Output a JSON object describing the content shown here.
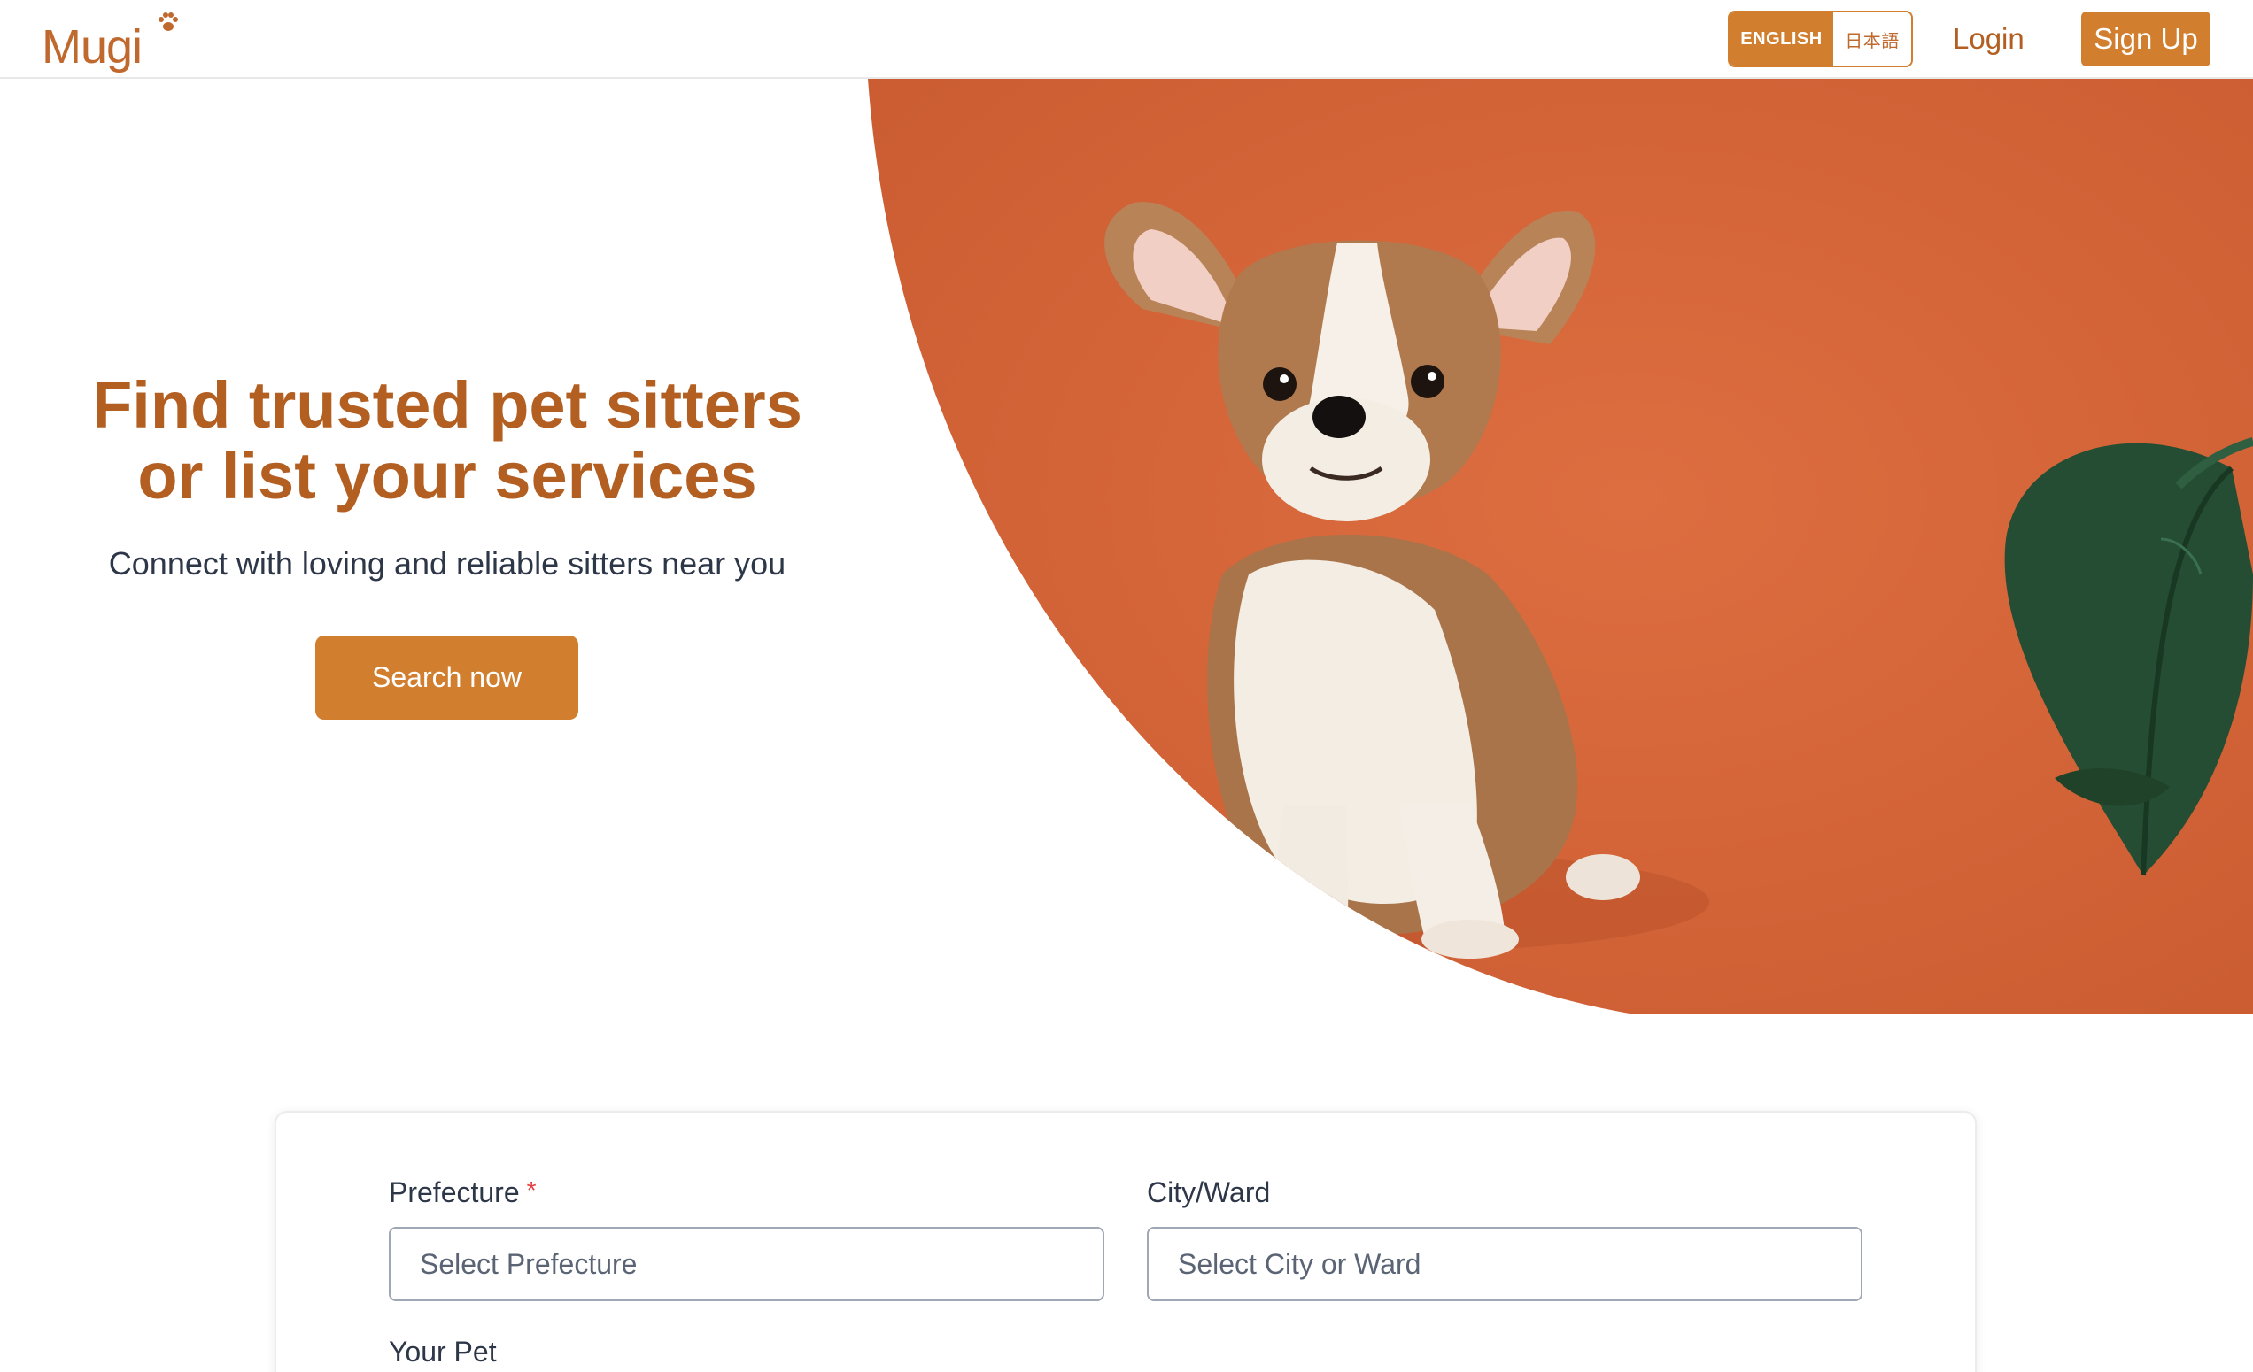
{
  "header": {
    "logo_text": "Mugi",
    "lang_english": "ENGLISH",
    "lang_japanese": "日本語",
    "login_label": "Login",
    "signup_label": "Sign Up"
  },
  "hero": {
    "title_line1": "Find trusted pet sitters",
    "title_line2": "or list your services",
    "subtitle": "Connect with loving and reliable sitters near you",
    "cta_label": "Search now"
  },
  "search_form": {
    "prefecture_label": "Prefecture",
    "prefecture_required_mark": "*",
    "prefecture_placeholder": "Select Prefecture",
    "city_label": "City/Ward",
    "city_placeholder": "Select City or Ward",
    "pet_label": "Your Pet"
  },
  "colors": {
    "brand": "#d17f2e",
    "brand_text": "#b35f22",
    "hero_background": "#d6643a",
    "required": "#e53e3e"
  },
  "icons": {
    "logo_paw": "paw-icon"
  }
}
